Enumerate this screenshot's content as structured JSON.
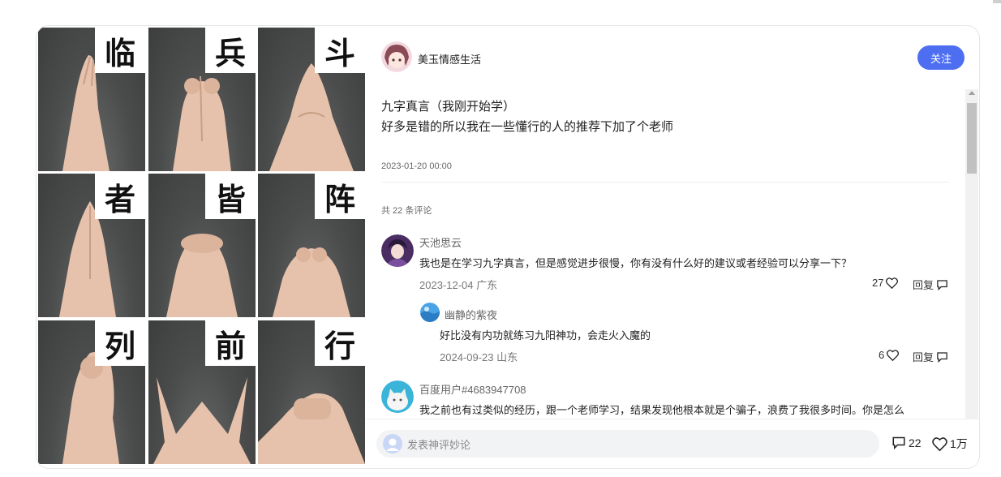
{
  "post": {
    "author": "美玉情感生活",
    "follow_label": "关注",
    "title": "九字真言（我刚开始学）",
    "body": "好多是错的所以我在一些懂行的人的推荐下加了个老师",
    "date": "2023-01-20 00:00",
    "images": [
      {
        "char": "临",
        "icon": "hands-steeple"
      },
      {
        "char": "兵",
        "icon": "hands-interlock"
      },
      {
        "char": "斗",
        "icon": "hands-triangle"
      },
      {
        "char": "者",
        "icon": "hands-steeple"
      },
      {
        "char": "皆",
        "icon": "hands-clasp"
      },
      {
        "char": "阵",
        "icon": "hands-interlock"
      },
      {
        "char": "列",
        "icon": "hand-fist"
      },
      {
        "char": "前",
        "icon": "hands-triangle-open"
      },
      {
        "char": "行",
        "icon": "hands-clasp"
      }
    ]
  },
  "comments": {
    "count_label": "共 22 条评论",
    "items": [
      {
        "user": "天池思云",
        "text": "我也是在学习九字真言，但是感觉进步很慢，你有没有什么好的建议或者经验可以分享一下？",
        "date_location": "2023-12-04 广东",
        "likes": "27",
        "reply_label": "回复",
        "replies": [
          {
            "user": "幽静的紫夜",
            "text": "好比没有内功就练习九阳神功，会走火入魔的",
            "date_location": "2024-09-23 山东",
            "likes": "6",
            "reply_label": "回复"
          }
        ]
      },
      {
        "user": "百度用户#4683947708",
        "text": "我之前也有过类似的经历，跟一个老师学习，结果发现他根本就是个骗子，浪费了我很多时间。你是怎么"
      }
    ]
  },
  "footer": {
    "input_placeholder": "发表神评妙论",
    "comment_total": "22",
    "like_total": "1万"
  },
  "colors": {
    "accent": "#4e6ef2",
    "input_bg": "#f2f3f5",
    "photo_bg": "#4b4c4c"
  }
}
